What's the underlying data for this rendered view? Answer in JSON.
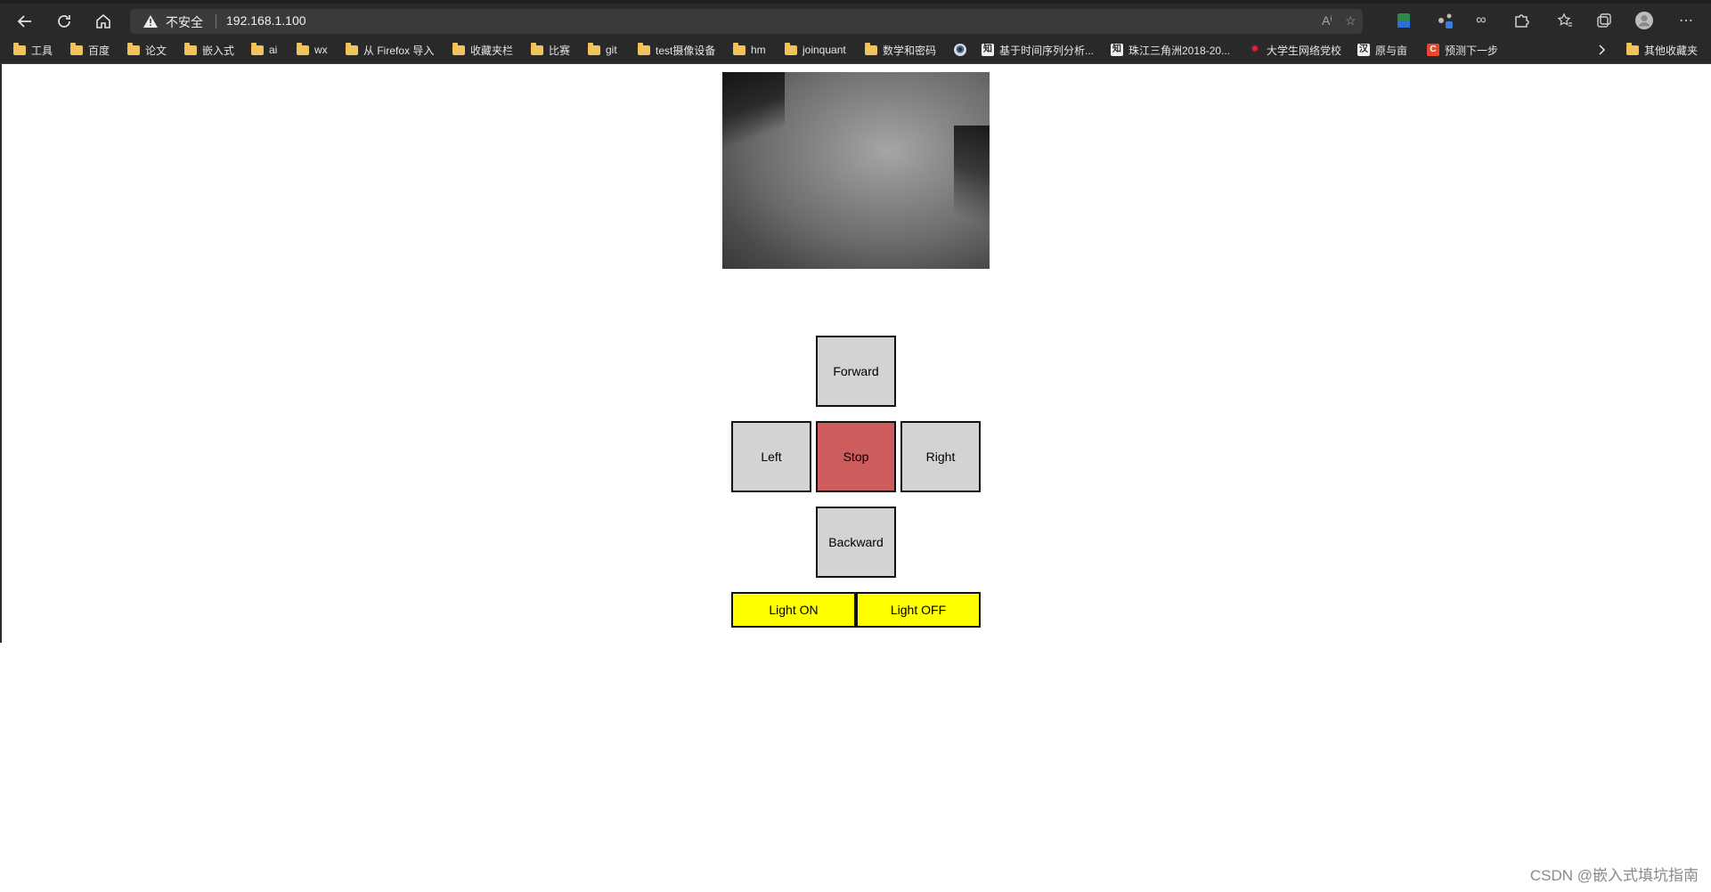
{
  "browser": {
    "address": {
      "security_label": "不安全",
      "url": "192.168.1.100"
    },
    "bookmarks": [
      {
        "label": "工具",
        "icon": "folder-icon"
      },
      {
        "label": "百度",
        "icon": "folder-icon"
      },
      {
        "label": "论文",
        "icon": "folder-icon"
      },
      {
        "label": "嵌入式",
        "icon": "folder-icon"
      },
      {
        "label": "ai",
        "icon": "folder-icon"
      },
      {
        "label": "wx",
        "icon": "folder-icon"
      },
      {
        "label": "从 Firefox 导入",
        "icon": "folder-icon"
      },
      {
        "label": "收藏夹栏",
        "icon": "folder-icon"
      },
      {
        "label": "比赛",
        "icon": "folder-icon"
      },
      {
        "label": "git",
        "icon": "folder-icon"
      },
      {
        "label": "test摄像设备",
        "icon": "folder-icon"
      },
      {
        "label": "hm",
        "icon": "folder-icon"
      },
      {
        "label": "joinquant",
        "icon": "folder-icon"
      },
      {
        "label": "数学和密码",
        "icon": "folder-icon"
      },
      {
        "label": "基于时间序列分析...",
        "icon": "site-favicon"
      },
      {
        "label": "珠江三角洲2018-20...",
        "icon": "site-favicon"
      },
      {
        "label": "大学生网络党校",
        "icon": "site-favicon"
      },
      {
        "label": "原与亩",
        "icon": "site-favicon"
      },
      {
        "label": "预测下一步",
        "icon": "site-favicon"
      }
    ],
    "other_bookmarks": "其他收藏夹"
  },
  "controls": {
    "forward": "Forward",
    "left": "Left",
    "stop": "Stop",
    "right": "Right",
    "backward": "Backward",
    "light_on": "Light ON",
    "light_off": "Light OFF"
  },
  "colors": {
    "button_bg": "#d3d3d3",
    "stop_bg": "#cd5c5c",
    "light_bg": "#ffff00"
  },
  "watermark": "CSDN @嵌入式填坑指南"
}
